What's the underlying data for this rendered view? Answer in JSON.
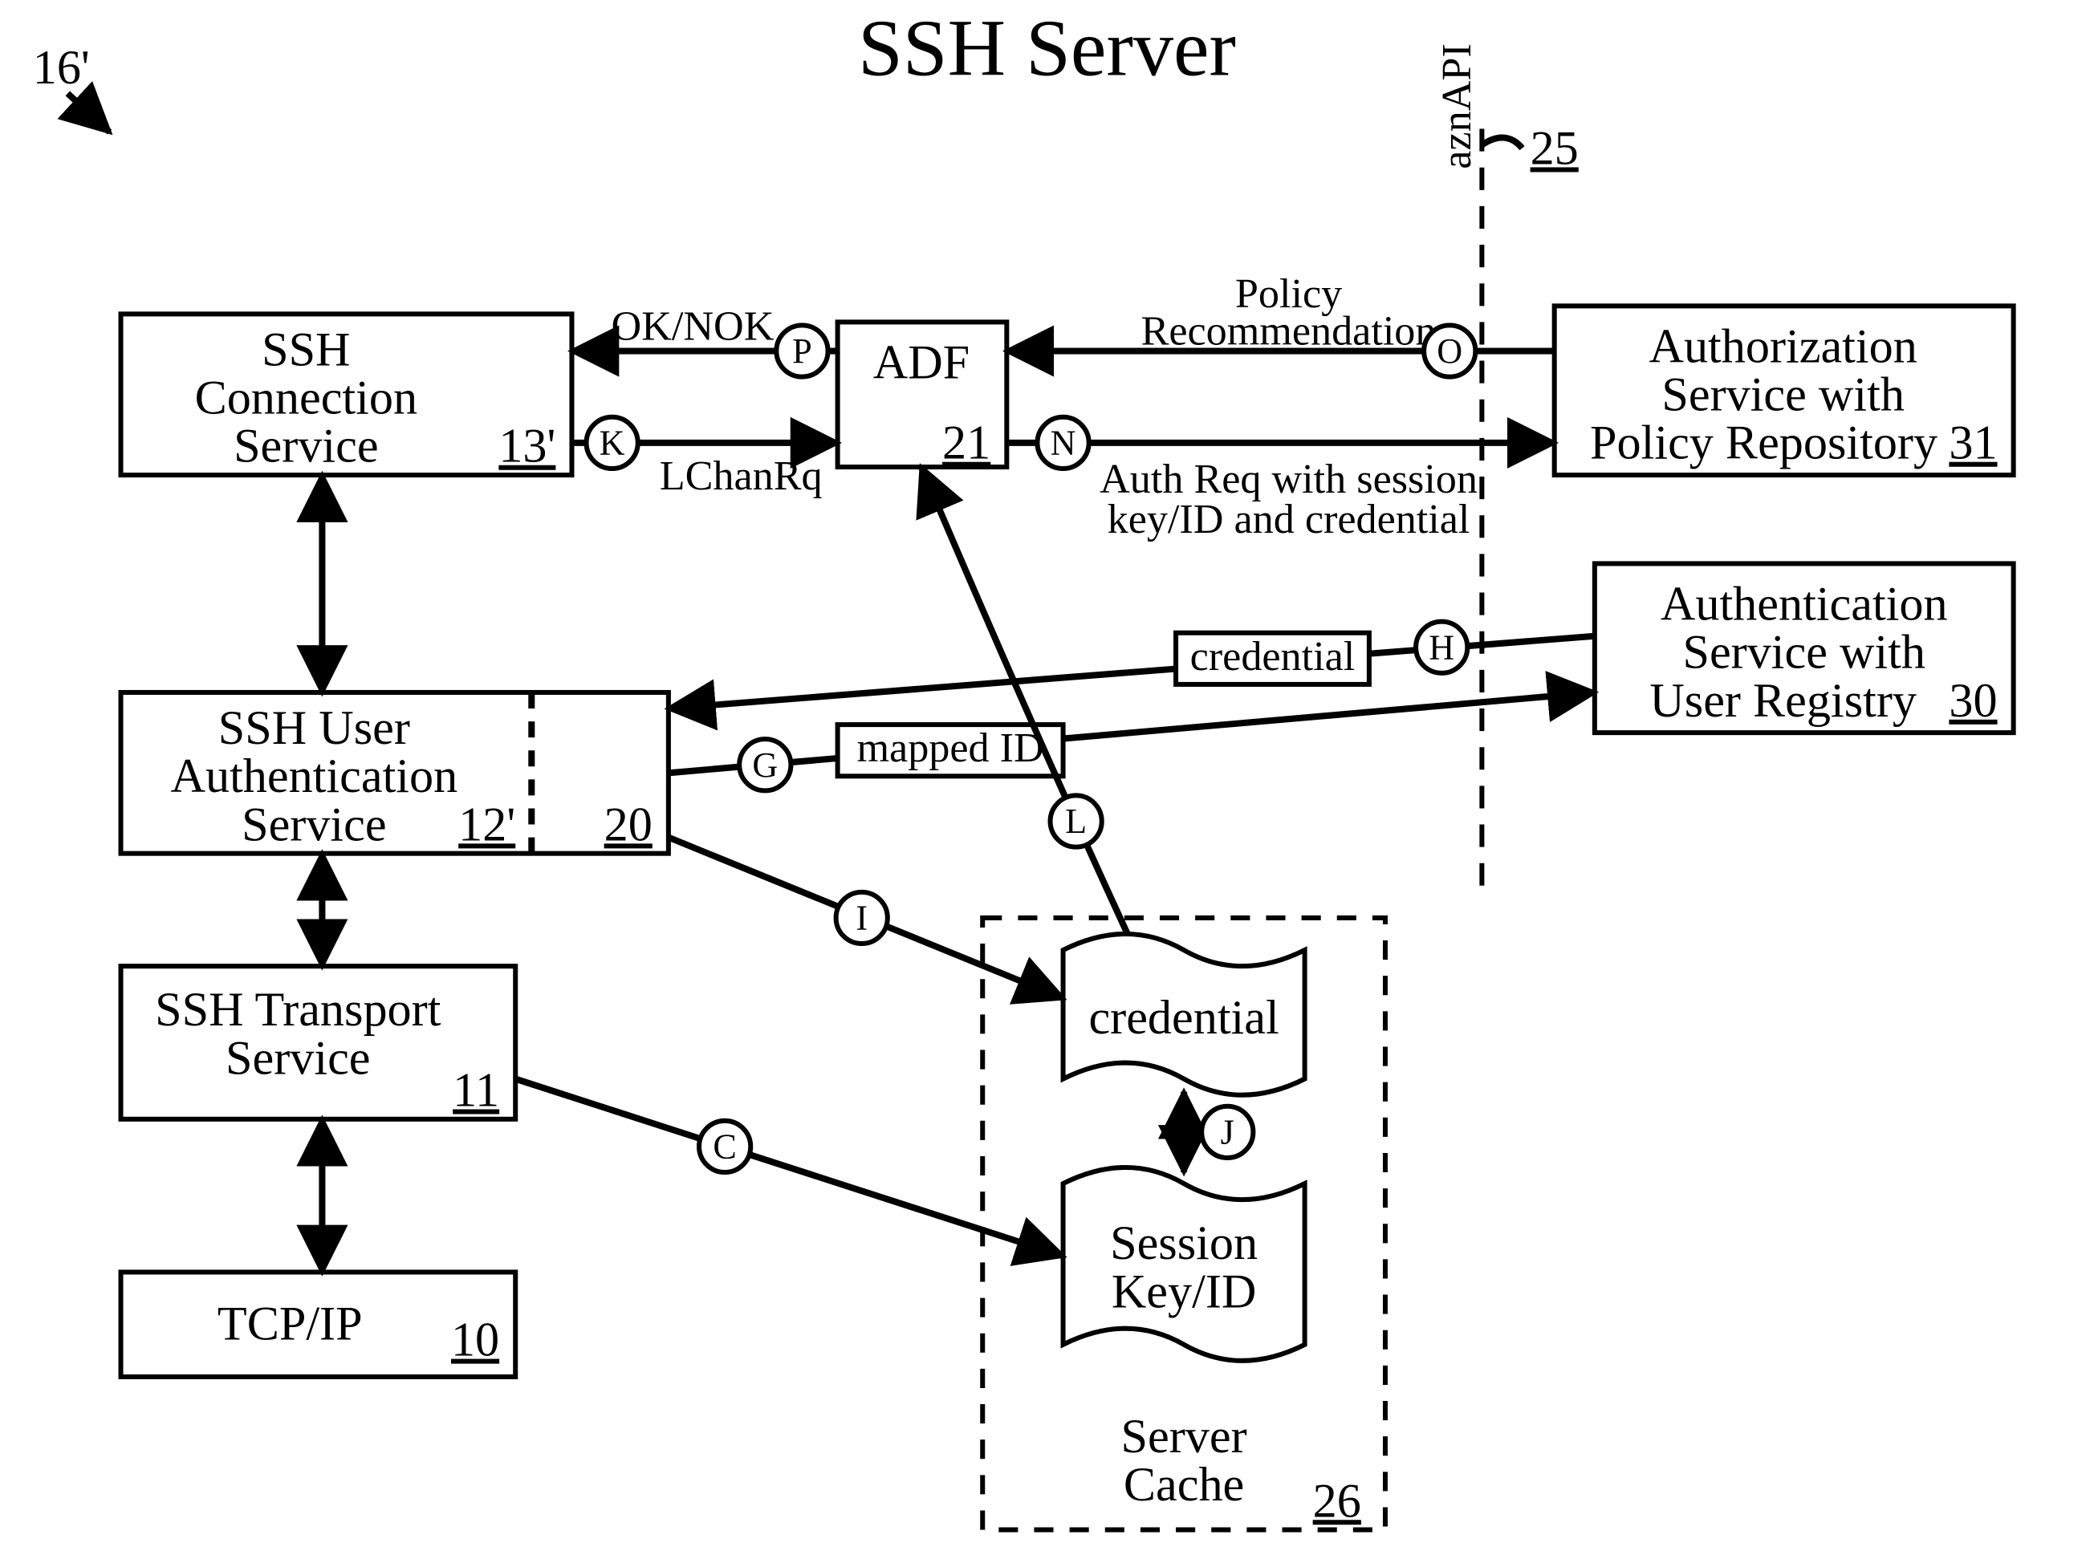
{
  "title": "SSH Server",
  "figure_ref": "16'",
  "api_label": "aznAPI",
  "api_ref": "25",
  "boxes": {
    "conn": {
      "title_l1": "SSH",
      "title_l2": "Connection",
      "title_l3": "Service",
      "ref": "13'"
    },
    "uauth": {
      "title_l1": "SSH User",
      "title_l2": "Authentication",
      "title_l3": "Service",
      "ref": "12'",
      "sub_ref": "20"
    },
    "trans": {
      "title_l1": "SSH Transport",
      "title_l2": "Service",
      "ref": "11"
    },
    "tcp": {
      "title_l1": "TCP/IP",
      "ref": "10"
    },
    "adf": {
      "title_l1": "ADF",
      "ref": "21"
    },
    "authz": {
      "title_l1": "Authorization",
      "title_l2": "Service with",
      "title_l3": "Policy Repository",
      "ref": "31"
    },
    "authn": {
      "title_l1": "Authentication",
      "title_l2": "Service with",
      "title_l3": "User Registry",
      "ref": "30"
    },
    "cache": {
      "title_l1": "Server",
      "title_l2": "Cache",
      "ref": "26"
    },
    "doc_cred": {
      "label": "credential"
    },
    "doc_sess": {
      "label_l1": "Session",
      "label_l2": "Key/ID"
    }
  },
  "edge_labels": {
    "ok_nok": "OK/NOK",
    "lchanrq": "LChanRq",
    "policy_rec": "Policy",
    "policy_rec2": "Recommendation",
    "auth_req_l1": "Auth Req with session",
    "auth_req_l2": "key/ID and credential",
    "mapped_id": "mapped ID",
    "credential": "credential"
  },
  "steps": {
    "P": "P",
    "K": "K",
    "O": "O",
    "N": "N",
    "H": "H",
    "G": "G",
    "L": "L",
    "I": "I",
    "J": "J",
    "C": "C"
  }
}
